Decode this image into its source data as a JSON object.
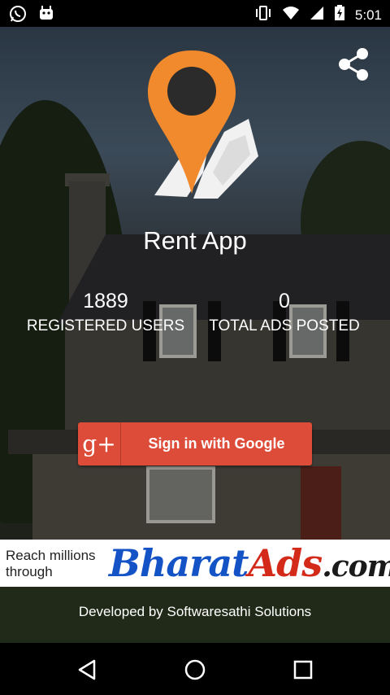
{
  "status_bar": {
    "time": "5:01",
    "left_icons": [
      "whatsapp-icon",
      "android-debug-icon"
    ],
    "right_icons": [
      "vibrate-icon",
      "wifi-icon",
      "signal-icon",
      "battery-charging-icon"
    ]
  },
  "app": {
    "title": "Rent App",
    "share_icon": "share-icon"
  },
  "stats": {
    "registered_users_value": "1889",
    "registered_users_label": "REGISTERED USERS",
    "total_ads_value": "0",
    "total_ads_label": "TOTAL ADS POSTED"
  },
  "signin": {
    "label": "Sign in with Google",
    "icon_text": "g+",
    "color": "#dd4b39"
  },
  "ad_banner": {
    "tagline_line1": "Reach millions",
    "tagline_line2": "through",
    "brand_part1": "Bharat",
    "brand_part2": "Ads",
    "brand_part3": ".com"
  },
  "footer": {
    "developer": "Developed by Softwaresathi Solutions"
  },
  "nav_bar": {
    "buttons": [
      "back-icon",
      "home-icon",
      "recents-icon"
    ]
  },
  "colors": {
    "accent_orange": "#f08a2c",
    "google_red": "#dd4b39"
  }
}
